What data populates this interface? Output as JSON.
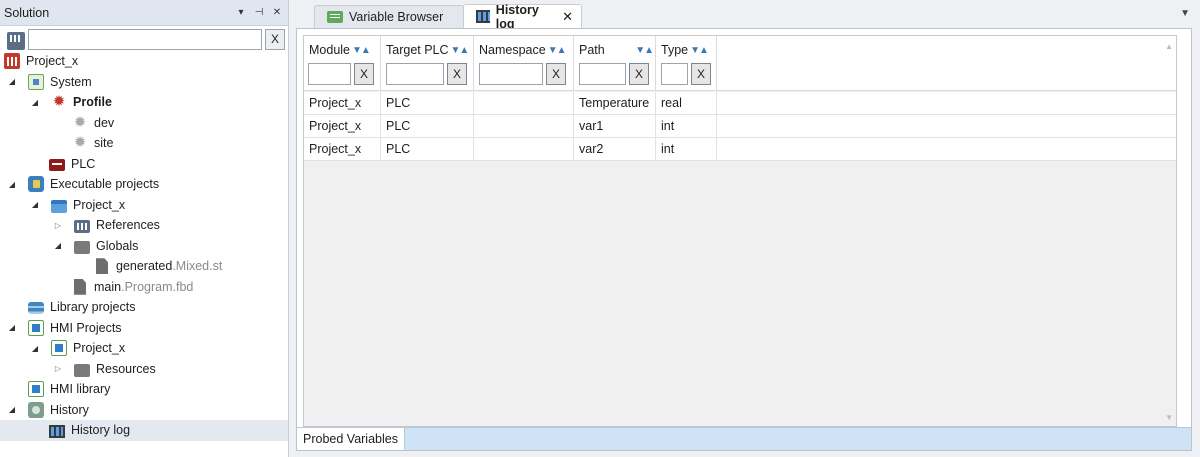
{
  "solution": {
    "title": "Solution",
    "header_buttons": [
      "▾",
      "⊣",
      "✕"
    ],
    "search": {
      "value": "",
      "placeholder": "",
      "clear_label": "X"
    },
    "tree": {
      "root": "Project_x",
      "system": "System",
      "profile": "Profile",
      "dev": "dev",
      "site": "site",
      "plc": "PLC",
      "executable_projects": "Executable projects",
      "exec_project": "Project_x",
      "references": "References",
      "globals": "Globals",
      "generated_name": "generated",
      "generated_ext": ".Mixed.st",
      "main_name": "main",
      "main_ext": ".Program.fbd",
      "library_projects": "Library projects",
      "hmi_projects": "HMI Projects",
      "hmi_project": "Project_x",
      "resources": "Resources",
      "hmi_library": "HMI library",
      "history": "History",
      "history_log": "History log"
    }
  },
  "tabs": {
    "variable_browser": "Variable Browser",
    "history_log": "History log",
    "close": "✕",
    "overflow": "▼"
  },
  "grid": {
    "columns": [
      "Module",
      "Target PLC",
      "Namespace",
      "Path",
      "Type"
    ],
    "sort_glyph": "▼▲",
    "filter_clear_label": "X",
    "rows": [
      [
        "Project_x",
        "PLC",
        "",
        "Temperature",
        "real"
      ],
      [
        "Project_x",
        "PLC",
        "",
        "var1",
        "int"
      ],
      [
        "Project_x",
        "PLC",
        "",
        "var2",
        "int"
      ]
    ]
  },
  "bottom_tabs": {
    "probed_variables": "Probed Variables"
  },
  "icons": {
    "scroll_up": "▲",
    "scroll_down": "▼",
    "gear": "✹"
  }
}
